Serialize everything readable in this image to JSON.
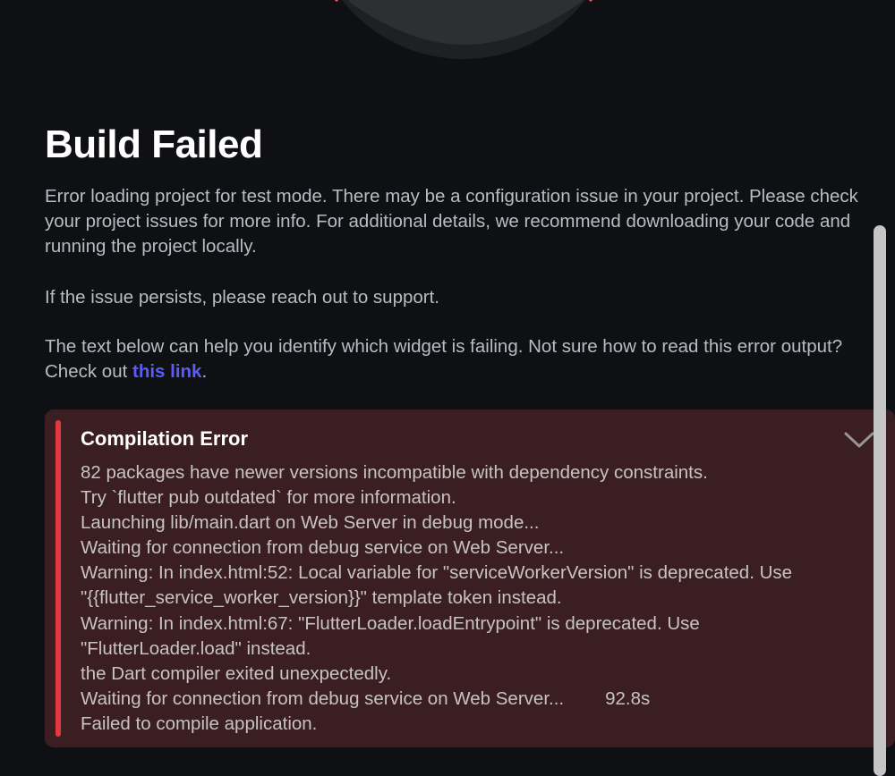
{
  "title": "Build Failed",
  "description": {
    "paragraph1": "Error loading project for test mode. There may be a configuration issue in your project. Please check your project issues for more info. For additional details, we recommend downloading your code and running the project locally.",
    "paragraph2": "If the issue persists, please reach out to support.",
    "paragraph3_before_link": "The text below can help you identify which widget is failing. Not sure how to read this error output? Check out ",
    "link_text": "this link",
    "paragraph3_after_link": "."
  },
  "error": {
    "title": "Compilation Error",
    "lines": [
      "82 packages have newer versions incompatible with dependency constraints.",
      "Try `flutter pub outdated` for more information.",
      "Launching lib/main.dart on Web Server in debug mode...",
      "Waiting for connection from debug service on Web Server...",
      "Warning: In index.html:52: Local variable for \"serviceWorkerVersion\" is deprecated. Use",
      "\"{{flutter_service_worker_version}}\" template token instead.",
      "Warning: In index.html:67: \"FlutterLoader.loadEntrypoint\" is deprecated. Use",
      "\"FlutterLoader.load\" instead.",
      "the Dart compiler exited unexpectedly.",
      "Waiting for connection from debug service on Web Server...",
      "Failed to compile application."
    ],
    "timer": "92.8s",
    "toggle_icon": "chevron-down-icon"
  },
  "colors": {
    "background": "#0e1014",
    "error_panel": "#3b1e22",
    "error_accent": "#e2383f",
    "link": "#5b5cf5",
    "illustration_accent": "#f05a5e"
  }
}
